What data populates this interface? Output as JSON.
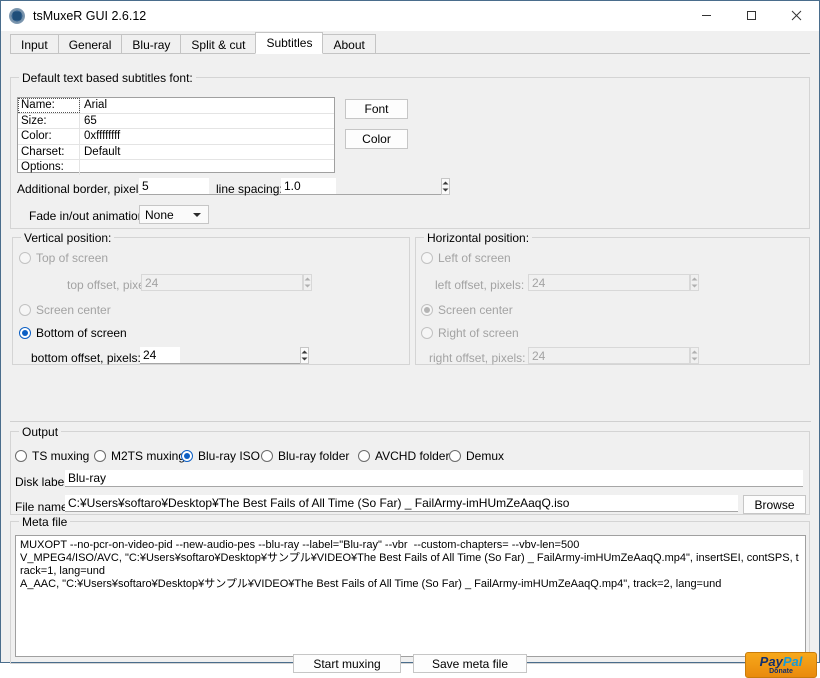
{
  "window": {
    "title": "tsMuxeR GUI 2.6.12",
    "icon": "app-gear-icon",
    "minimize": "minimize-icon",
    "maximize": "maximize-icon",
    "close": "close-icon"
  },
  "tabs": [
    {
      "label": "Input",
      "active": false
    },
    {
      "label": "General",
      "active": false
    },
    {
      "label": "Blu-ray",
      "active": false
    },
    {
      "label": "Split & cut",
      "active": false
    },
    {
      "label": "Subtitles",
      "active": true
    },
    {
      "label": "About",
      "active": false
    }
  ],
  "font_group": {
    "title": "Default text based subtitles font:",
    "rows": [
      {
        "key": "Name:",
        "value": "Arial"
      },
      {
        "key": "Size:",
        "value": "65"
      },
      {
        "key": "Color:",
        "value": "0xffffffff"
      },
      {
        "key": "Charset:",
        "value": "Default"
      },
      {
        "key": "Options:",
        "value": ""
      }
    ],
    "font_button": "Font",
    "color_button": "Color",
    "border_label": "Additional border, pixels:",
    "border_value": "5",
    "line_spacing_label": "line spacing:",
    "line_spacing_value": "1.0",
    "fade_label": "Fade in/out animation:",
    "fade_value": "None"
  },
  "vertical_position": {
    "title": "Vertical position:",
    "options": [
      {
        "label": "Top of screen",
        "checked": false,
        "disabled": true
      },
      {
        "label": "Screen center",
        "checked": false,
        "disabled": true
      },
      {
        "label": "Bottom of screen",
        "checked": true,
        "disabled": false
      }
    ],
    "top_offset_label": "top offset, pixels:",
    "top_offset_value": "24",
    "bottom_offset_label": "bottom offset, pixels:",
    "bottom_offset_value": "24"
  },
  "horizontal_position": {
    "title": "Horizontal position:",
    "options": [
      {
        "label": "Left of screen",
        "checked": false,
        "disabled": true
      },
      {
        "label": "Screen center",
        "checked": true,
        "disabled": true
      },
      {
        "label": "Right of screen",
        "checked": false,
        "disabled": true
      }
    ],
    "left_offset_label": "left offset, pixels:",
    "left_offset_value": "24",
    "right_offset_label": "right offset, pixels:",
    "right_offset_value": "24"
  },
  "output": {
    "title": "Output",
    "modes": [
      {
        "label": "TS muxing",
        "checked": false
      },
      {
        "label": "M2TS muxing",
        "checked": false
      },
      {
        "label": "Blu-ray ISO",
        "checked": true
      },
      {
        "label": "Blu-ray folder",
        "checked": false
      },
      {
        "label": "AVCHD folder",
        "checked": false
      },
      {
        "label": "Demux",
        "checked": false
      }
    ],
    "disk_label_label": "Disk label",
    "disk_label_value": "Blu-ray",
    "file_name_label": "File name",
    "file_name_value": "C:¥Users¥softaro¥Desktop¥The Best Fails of All Time (So Far) _ FailArmy-imHUmZeAaqQ.iso",
    "browse_button": "Browse"
  },
  "meta_file": {
    "title": "Meta file",
    "content": "MUXOPT --no-pcr-on-video-pid --new-audio-pes --blu-ray --label=\"Blu-ray\" --vbr  --custom-chapters= --vbv-len=500\nV_MPEG4/ISO/AVC, \"C:¥Users¥softaro¥Desktop¥サンプル¥VIDEO¥The Best Fails of All Time (So Far) _ FailArmy-imHUmZeAaqQ.mp4\", insertSEI, contSPS, track=1, lang=und\nA_AAC, \"C:¥Users¥softaro¥Desktop¥サンプル¥VIDEO¥The Best Fails of All Time (So Far) _ FailArmy-imHUmZeAaqQ.mp4\", track=2, lang=und"
  },
  "footer": {
    "start_muxing": "Start muxing",
    "save_meta_file": "Save meta file",
    "paypal_pay": "Pay",
    "paypal_pal": "Pal",
    "paypal_sub": "Donate"
  },
  "colors": {
    "accent_blue": "#0c5fc4",
    "window_border": "#4a6d8c",
    "background": "#f0f0f0",
    "paypal_orange": "#f7a81b"
  }
}
